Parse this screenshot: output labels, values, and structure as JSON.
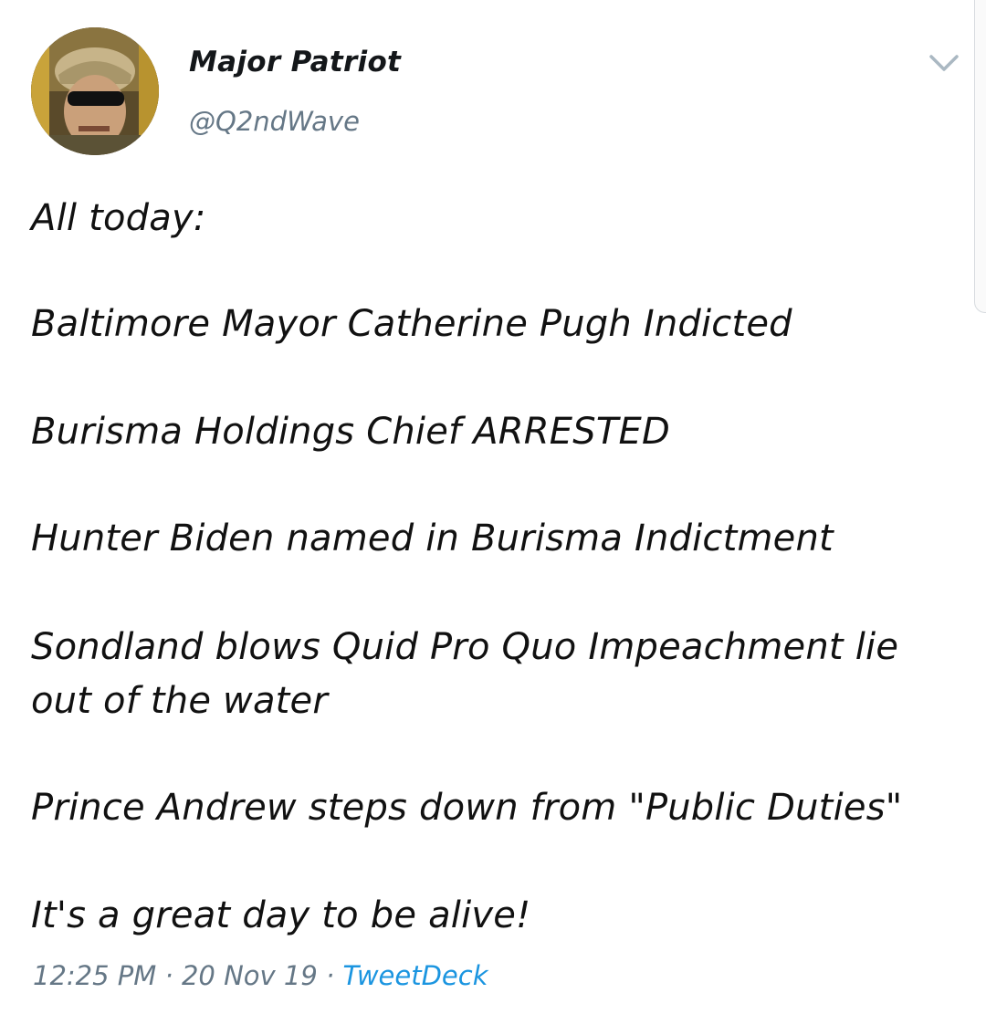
{
  "author": {
    "display_name": "Major Patriot",
    "handle": "@Q2ndWave"
  },
  "tweet": {
    "lines": [
      "All today:",
      "Baltimore Mayor Catherine Pugh Indicted",
      "Burisma Holdings Chief ARRESTED",
      "Hunter Biden named in Burisma Indictment",
      "Sondland blows Quid Pro Quo Impeachment lie",
      "out of the water",
      "Prince Andrew steps down from \"Public Duties\"",
      "It's a great day to be alive!"
    ]
  },
  "meta": {
    "time": "12:25 PM",
    "separator": "·",
    "date": "20 Nov 19",
    "source": "TweetDeck"
  },
  "icons": {
    "menu": "chevron-down-icon"
  },
  "colors": {
    "text": "#14171a",
    "secondary": "#657786",
    "link": "#1b95e0"
  }
}
